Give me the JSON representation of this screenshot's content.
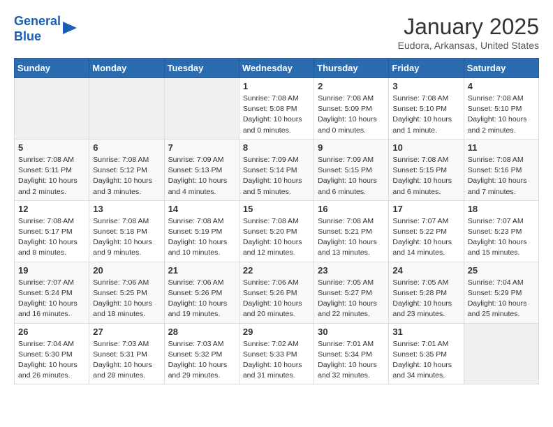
{
  "header": {
    "logo_line1": "General",
    "logo_line2": "Blue",
    "month_title": "January 2025",
    "location": "Eudora, Arkansas, United States"
  },
  "weekdays": [
    "Sunday",
    "Monday",
    "Tuesday",
    "Wednesday",
    "Thursday",
    "Friday",
    "Saturday"
  ],
  "weeks": [
    [
      null,
      null,
      null,
      {
        "day": 1,
        "sunrise": "7:08 AM",
        "sunset": "5:08 PM",
        "daylight": "10 hours and 0 minutes."
      },
      {
        "day": 2,
        "sunrise": "7:08 AM",
        "sunset": "5:09 PM",
        "daylight": "10 hours and 0 minutes."
      },
      {
        "day": 3,
        "sunrise": "7:08 AM",
        "sunset": "5:10 PM",
        "daylight": "10 hours and 1 minute."
      },
      {
        "day": 4,
        "sunrise": "7:08 AM",
        "sunset": "5:10 PM",
        "daylight": "10 hours and 2 minutes."
      }
    ],
    [
      {
        "day": 5,
        "sunrise": "7:08 AM",
        "sunset": "5:11 PM",
        "daylight": "10 hours and 2 minutes."
      },
      {
        "day": 6,
        "sunrise": "7:08 AM",
        "sunset": "5:12 PM",
        "daylight": "10 hours and 3 minutes."
      },
      {
        "day": 7,
        "sunrise": "7:09 AM",
        "sunset": "5:13 PM",
        "daylight": "10 hours and 4 minutes."
      },
      {
        "day": 8,
        "sunrise": "7:09 AM",
        "sunset": "5:14 PM",
        "daylight": "10 hours and 5 minutes."
      },
      {
        "day": 9,
        "sunrise": "7:09 AM",
        "sunset": "5:15 PM",
        "daylight": "10 hours and 6 minutes."
      },
      {
        "day": 10,
        "sunrise": "7:08 AM",
        "sunset": "5:15 PM",
        "daylight": "10 hours and 6 minutes."
      },
      {
        "day": 11,
        "sunrise": "7:08 AM",
        "sunset": "5:16 PM",
        "daylight": "10 hours and 7 minutes."
      }
    ],
    [
      {
        "day": 12,
        "sunrise": "7:08 AM",
        "sunset": "5:17 PM",
        "daylight": "10 hours and 8 minutes."
      },
      {
        "day": 13,
        "sunrise": "7:08 AM",
        "sunset": "5:18 PM",
        "daylight": "10 hours and 9 minutes."
      },
      {
        "day": 14,
        "sunrise": "7:08 AM",
        "sunset": "5:19 PM",
        "daylight": "10 hours and 10 minutes."
      },
      {
        "day": 15,
        "sunrise": "7:08 AM",
        "sunset": "5:20 PM",
        "daylight": "10 hours and 12 minutes."
      },
      {
        "day": 16,
        "sunrise": "7:08 AM",
        "sunset": "5:21 PM",
        "daylight": "10 hours and 13 minutes."
      },
      {
        "day": 17,
        "sunrise": "7:07 AM",
        "sunset": "5:22 PM",
        "daylight": "10 hours and 14 minutes."
      },
      {
        "day": 18,
        "sunrise": "7:07 AM",
        "sunset": "5:23 PM",
        "daylight": "10 hours and 15 minutes."
      }
    ],
    [
      {
        "day": 19,
        "sunrise": "7:07 AM",
        "sunset": "5:24 PM",
        "daylight": "10 hours and 16 minutes."
      },
      {
        "day": 20,
        "sunrise": "7:06 AM",
        "sunset": "5:25 PM",
        "daylight": "10 hours and 18 minutes."
      },
      {
        "day": 21,
        "sunrise": "7:06 AM",
        "sunset": "5:26 PM",
        "daylight": "10 hours and 19 minutes."
      },
      {
        "day": 22,
        "sunrise": "7:06 AM",
        "sunset": "5:26 PM",
        "daylight": "10 hours and 20 minutes."
      },
      {
        "day": 23,
        "sunrise": "7:05 AM",
        "sunset": "5:27 PM",
        "daylight": "10 hours and 22 minutes."
      },
      {
        "day": 24,
        "sunrise": "7:05 AM",
        "sunset": "5:28 PM",
        "daylight": "10 hours and 23 minutes."
      },
      {
        "day": 25,
        "sunrise": "7:04 AM",
        "sunset": "5:29 PM",
        "daylight": "10 hours and 25 minutes."
      }
    ],
    [
      {
        "day": 26,
        "sunrise": "7:04 AM",
        "sunset": "5:30 PM",
        "daylight": "10 hours and 26 minutes."
      },
      {
        "day": 27,
        "sunrise": "7:03 AM",
        "sunset": "5:31 PM",
        "daylight": "10 hours and 28 minutes."
      },
      {
        "day": 28,
        "sunrise": "7:03 AM",
        "sunset": "5:32 PM",
        "daylight": "10 hours and 29 minutes."
      },
      {
        "day": 29,
        "sunrise": "7:02 AM",
        "sunset": "5:33 PM",
        "daylight": "10 hours and 31 minutes."
      },
      {
        "day": 30,
        "sunrise": "7:01 AM",
        "sunset": "5:34 PM",
        "daylight": "10 hours and 32 minutes."
      },
      {
        "day": 31,
        "sunrise": "7:01 AM",
        "sunset": "5:35 PM",
        "daylight": "10 hours and 34 minutes."
      },
      null
    ]
  ],
  "labels": {
    "sunrise": "Sunrise:",
    "sunset": "Sunset:",
    "daylight": "Daylight:"
  }
}
